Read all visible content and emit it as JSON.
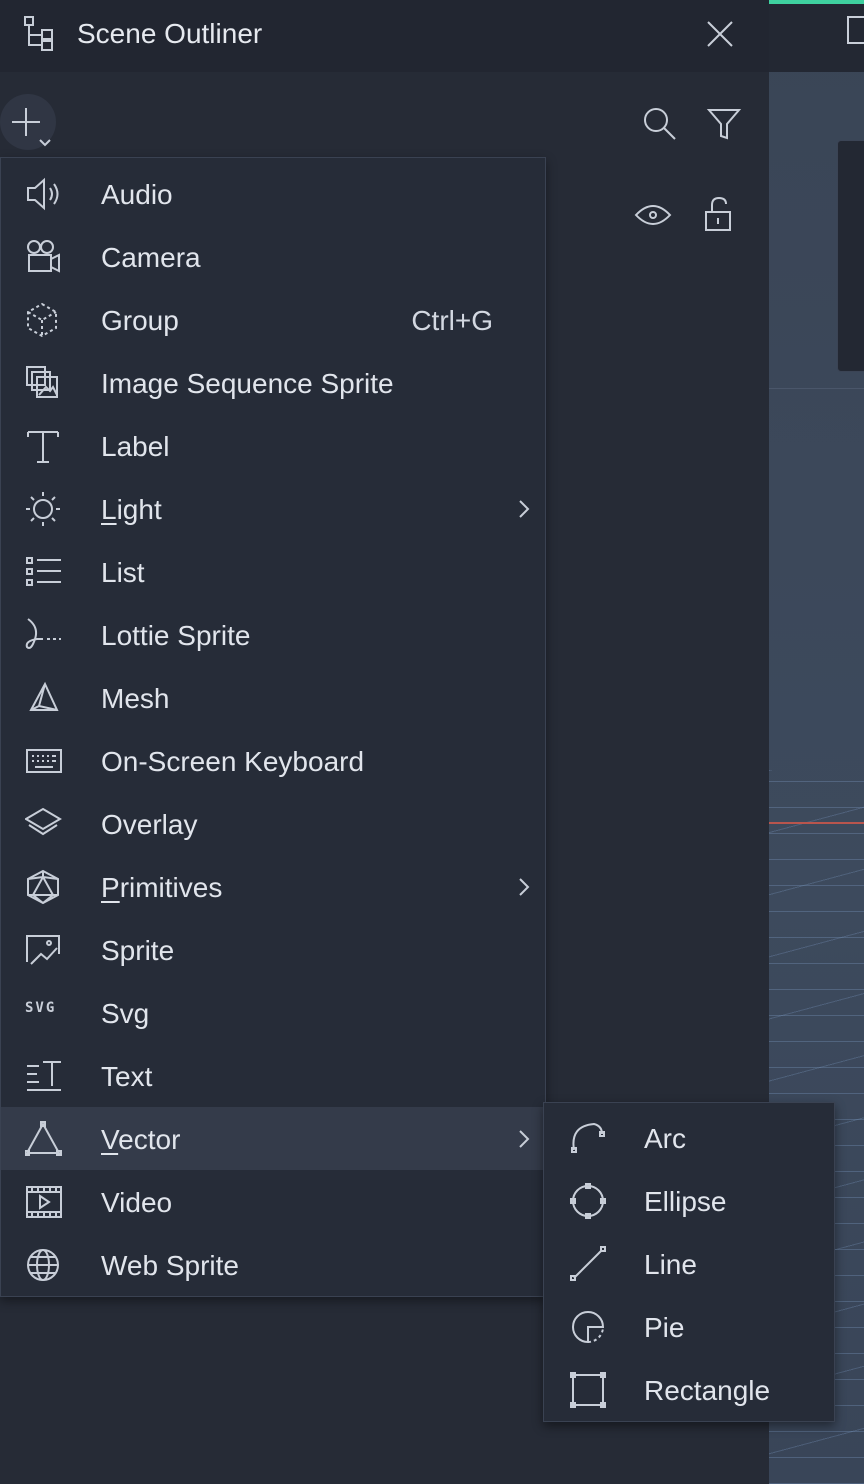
{
  "panel": {
    "title": "Scene Outliner"
  },
  "menu": {
    "items": [
      {
        "label": "Audio",
        "icon": "speaker-icon"
      },
      {
        "label": "Camera",
        "icon": "camera-icon"
      },
      {
        "label": "Group",
        "icon": "group-icon",
        "shortcut": "Ctrl+G"
      },
      {
        "label": "Image Sequence Sprite",
        "icon": "image-sequence-icon"
      },
      {
        "label": "Label",
        "icon": "text-t-icon"
      },
      {
        "label_first": "L",
        "label_rest": "ight",
        "icon": "sun-icon",
        "submenu": true
      },
      {
        "label": "List",
        "icon": "list-icon"
      },
      {
        "label": "Lottie Sprite",
        "icon": "lottie-icon"
      },
      {
        "label": "Mesh",
        "icon": "mesh-icon"
      },
      {
        "label": "On-Screen Keyboard",
        "icon": "keyboard-icon"
      },
      {
        "label": "Overlay",
        "icon": "layers-icon"
      },
      {
        "label_first": "P",
        "label_rest": "rimitives",
        "icon": "primitives-icon",
        "submenu": true
      },
      {
        "label": "Sprite",
        "icon": "sprite-icon"
      },
      {
        "label": "Svg",
        "icon": "svg-icon",
        "icon_text": "SVG"
      },
      {
        "label": "Text",
        "icon": "text-block-icon"
      },
      {
        "label_first": "V",
        "label_rest": "ector",
        "icon": "triangle-icon",
        "submenu": true,
        "active": true
      },
      {
        "label": "Video",
        "icon": "video-icon"
      },
      {
        "label": "Web Sprite",
        "icon": "globe-icon"
      }
    ]
  },
  "submenu": {
    "items": [
      {
        "label": "Arc",
        "icon": "arc-icon"
      },
      {
        "label": "Ellipse",
        "icon": "ellipse-icon"
      },
      {
        "label": "Line",
        "icon": "line-icon"
      },
      {
        "label": "Pie",
        "icon": "pie-icon"
      },
      {
        "label": "Rectangle",
        "icon": "rectangle-icon"
      }
    ]
  },
  "colors": {
    "panel_bg": "#262b36",
    "titlebar_bg": "#222631",
    "active_item_bg": "#343b4a",
    "accent": "#3fd1a0"
  }
}
